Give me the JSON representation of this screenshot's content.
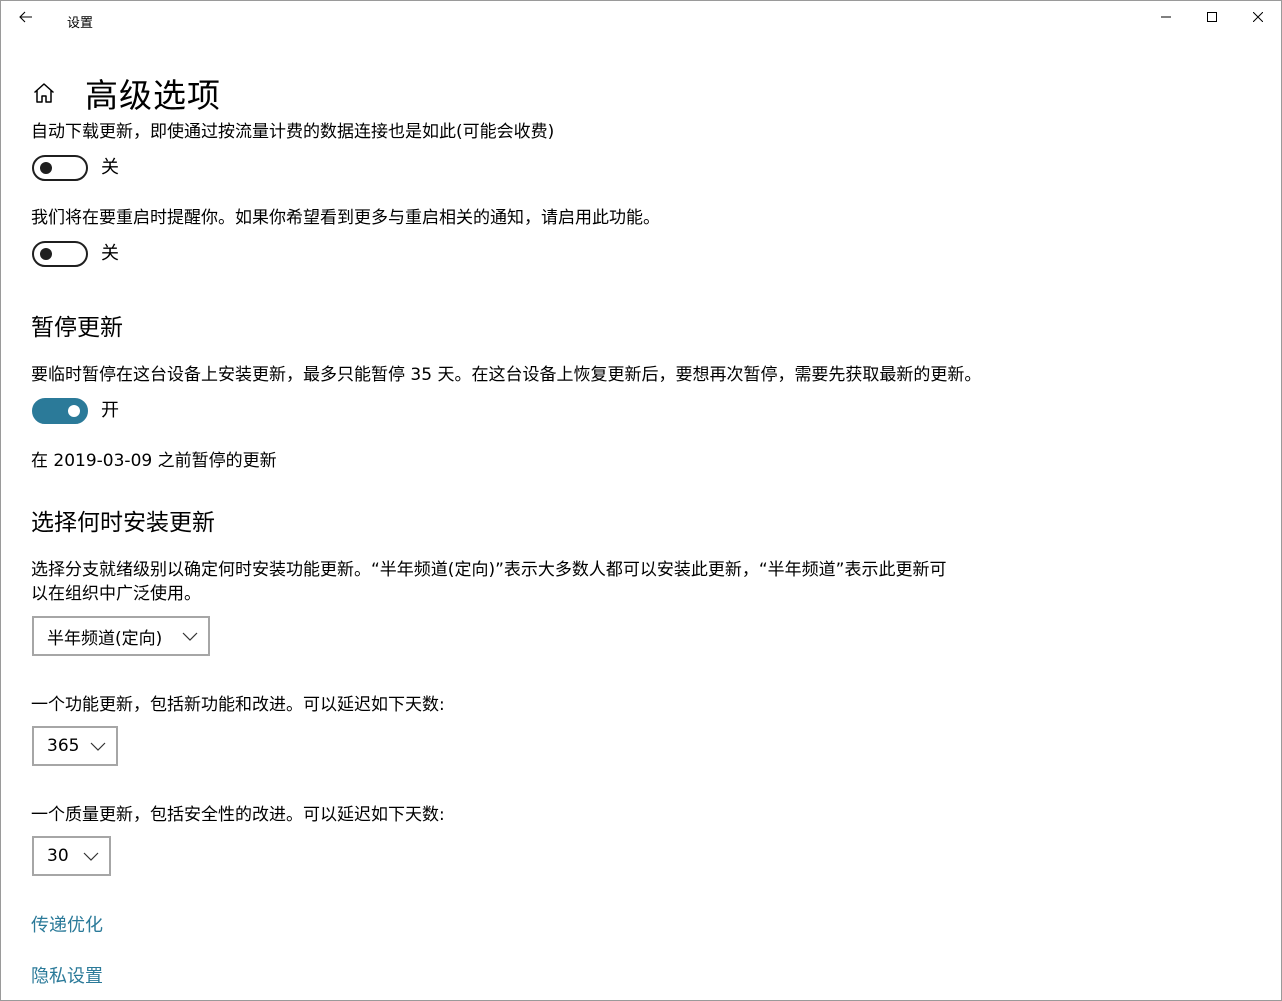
{
  "window": {
    "title": "设置"
  },
  "page": {
    "title": "高级选项"
  },
  "metered": {
    "description": "自动下载更新，即使通过按流量计费的数据连接也是如此(可能会收费)",
    "toggle_state": "关",
    "is_on": false
  },
  "restart_notify": {
    "description": "我们将在要重启时提醒你。如果你希望看到更多与重启相关的通知，请启用此功能。",
    "toggle_state": "关",
    "is_on": false
  },
  "pause": {
    "heading": "暂停更新",
    "description": "要临时暂停在这台设备上安装更新，最多只能暂停 35 天。在这台设备上恢复更新后，要想再次暂停，需要先获取最新的更新。",
    "toggle_state": "开",
    "is_on": true,
    "status": "在 2019-03-09 之前暂停的更新"
  },
  "choose": {
    "heading": "选择何时安装更新",
    "description_line1": "选择分支就绪级别以确定何时安装功能更新。“半年频道(定向)”表示大多数人都可以安装此更新，“半年频道”表示此更新可",
    "description_line2": "以在组织中广泛使用。",
    "branch_selected": "半年频道(定向)",
    "feature_label": "一个功能更新，包括新功能和改进。可以延迟如下天数:",
    "feature_days": "365",
    "quality_label": "一个质量更新，包括安全性的改进。可以延迟如下天数:",
    "quality_days": "30"
  },
  "links": {
    "delivery": "传递优化",
    "privacy": "隐私设置"
  },
  "colors": {
    "accent": "#2b7a99",
    "toggle_off": "#1f1f1f",
    "combo_border": "#a6a6a6"
  }
}
